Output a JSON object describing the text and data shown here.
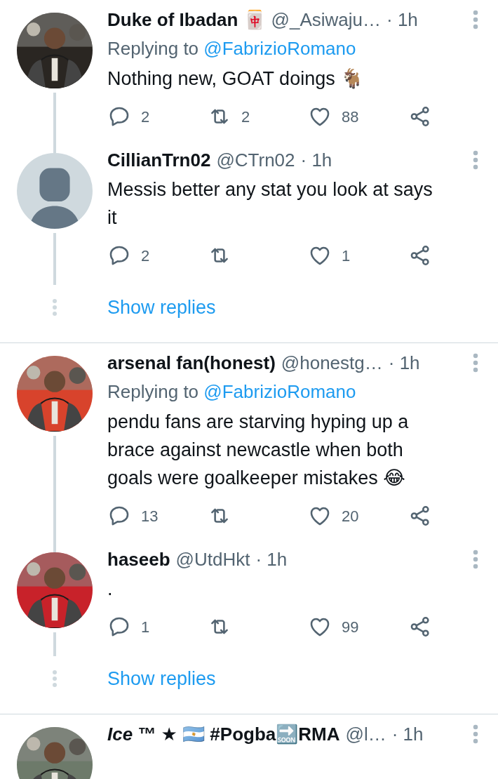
{
  "threads": [
    {
      "tweets": [
        {
          "name": "Duke of Ibadan 🀄",
          "handle": "@_Asiwaju…",
          "time": "· 1h",
          "replying_label": "Replying to",
          "replying_to": "@FabrizioRomano",
          "text": "Nothing new, GOAT doings 🐐",
          "replies": "2",
          "retweets": "2",
          "likes": "88"
        },
        {
          "avatar": {
            "kind": "default"
          },
          "name": "CillianTrn02",
          "handle": "@CTrn02",
          "time": "· 1h",
          "text": "Messis better any stat you look at says it",
          "replies": "2",
          "likes": "1"
        }
      ],
      "show_replies": "Show replies"
    },
    {
      "tweets": [
        {
          "name": "arsenal fan(honest)",
          "handle": "@honestg…",
          "time": "· 1h",
          "replying_label": "Replying to",
          "replying_to": "@FabrizioRomano",
          "text": "pendu fans are starving hyping up a brace against newcastle when both goals were goalkeeper mistakes 😂",
          "replies": "13",
          "likes": "20"
        },
        {
          "name": "haseeb",
          "handle": "@UtdHkt",
          "time": "· 1h",
          "text": ".",
          "replies": "1",
          "likes": "99"
        }
      ],
      "show_replies": "Show replies"
    },
    {
      "tweets": [
        {
          "name": "*Ice* ™ ★ 🇦🇷 #Pogba🔜RMA",
          "handle": "@l…",
          "time": "· 1h"
        }
      ]
    }
  ]
}
